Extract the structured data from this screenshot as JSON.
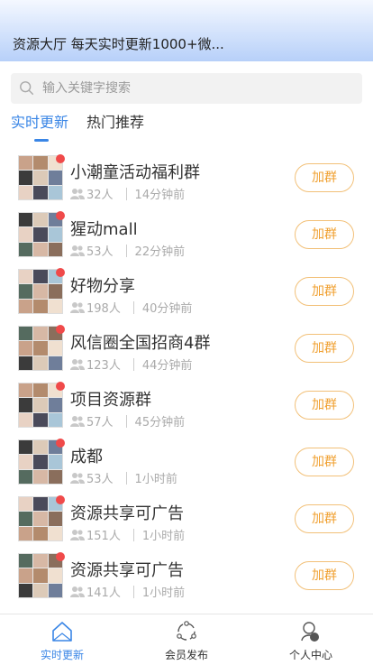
{
  "header": {
    "title": "资源大厅 每天实时更新1000+微..."
  },
  "search": {
    "placeholder": "输入关键字搜索"
  },
  "tabs": [
    {
      "label": "实时更新",
      "active": true
    },
    {
      "label": "热门推荐",
      "active": false
    }
  ],
  "groups": [
    {
      "name": "小潮童活动福利群",
      "members": "32人",
      "time": "14分钟前",
      "action": "加群"
    },
    {
      "name": "猩动mall",
      "members": "53人",
      "time": "22分钟前",
      "action": "加群"
    },
    {
      "name": "好物分享",
      "members": "198人",
      "time": "40分钟前",
      "action": "加群"
    },
    {
      "name": "风信圈全国招商4群",
      "members": "123人",
      "time": "44分钟前",
      "action": "加群"
    },
    {
      "name": "项目资源群",
      "members": "57人",
      "time": "45分钟前",
      "action": "加群"
    },
    {
      "name": "成都",
      "members": "53人",
      "time": "1小时前",
      "action": "加群"
    },
    {
      "name": "资源共享可广告",
      "members": "151人",
      "time": "1小时前",
      "action": "加群"
    },
    {
      "name": "资源共享可广告",
      "members": "141人",
      "time": "1小时前",
      "action": "加群"
    }
  ],
  "bottom_nav": [
    {
      "label": "实时更新",
      "icon": "home-icon",
      "active": true
    },
    {
      "label": "会员发布",
      "icon": "share-icon",
      "active": false
    },
    {
      "label": "个人中心",
      "icon": "user-icon",
      "active": false
    }
  ],
  "colors": {
    "accent": "#3a86e6",
    "join": "#f0a030",
    "badge": "#f04a4a"
  }
}
